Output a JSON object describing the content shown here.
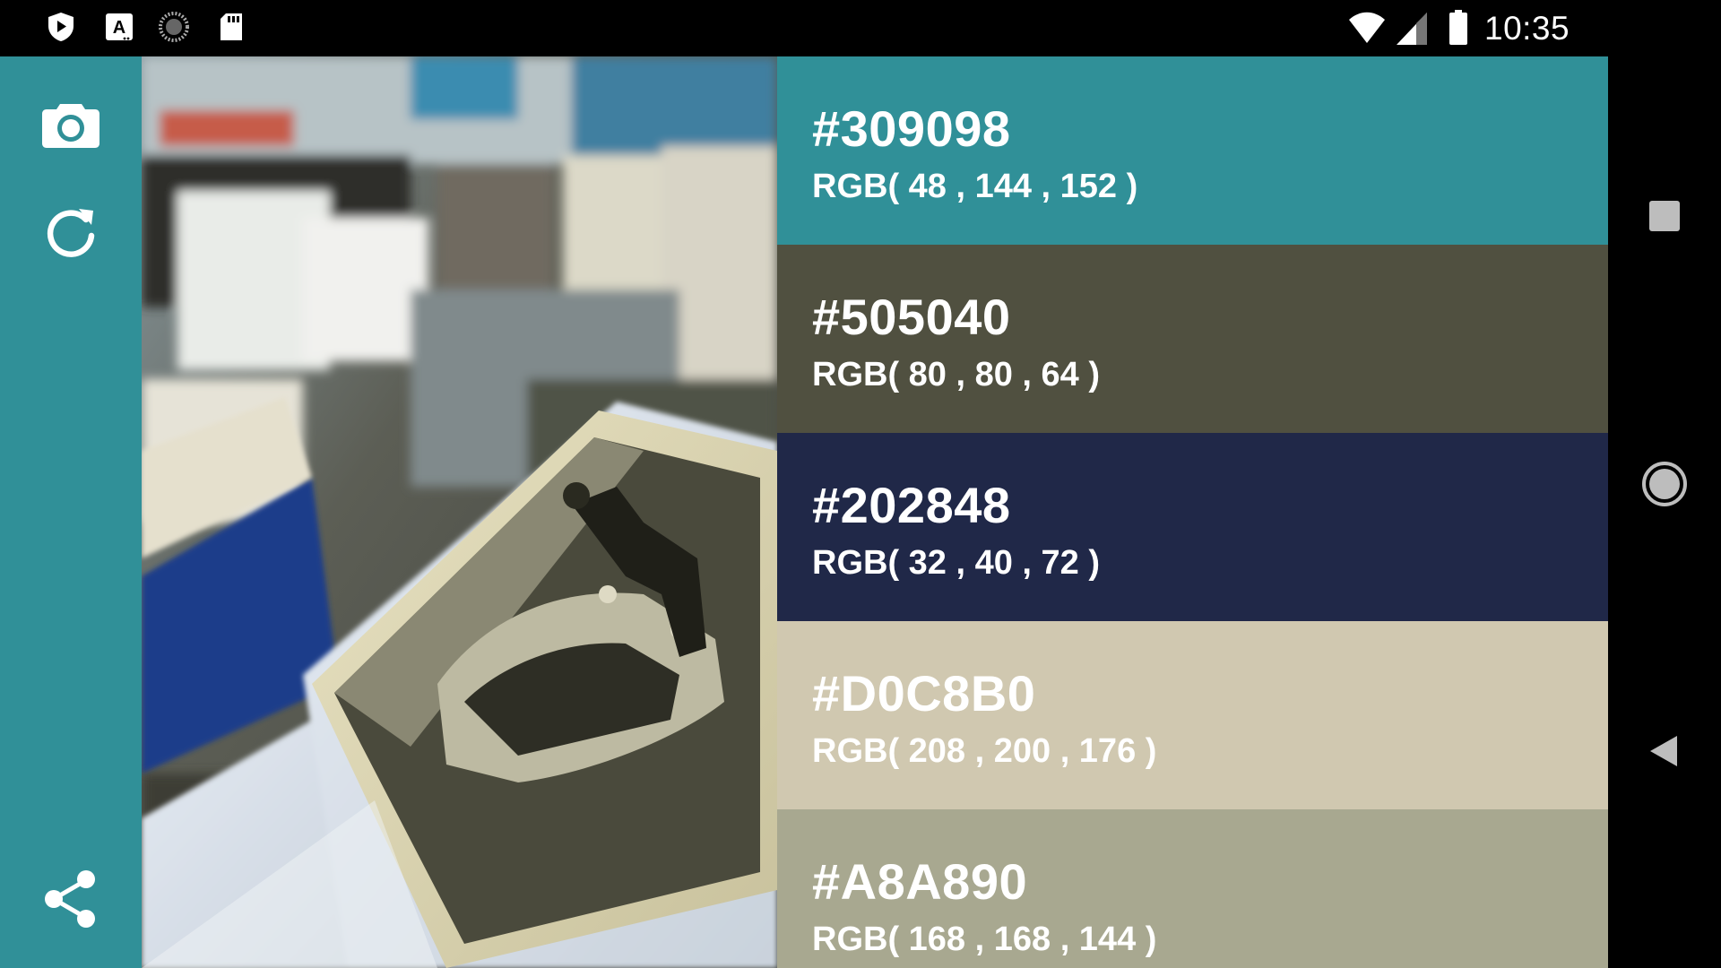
{
  "status_bar": {
    "time": "10:35",
    "icons": [
      "play-protect-icon",
      "font-a-icon",
      "loading-dial-icon",
      "sd-card-icon"
    ],
    "right_icons": [
      "wifi-icon",
      "cell-signal-icon",
      "battery-icon"
    ]
  },
  "rail": {
    "background": "#309098",
    "buttons": [
      "camera-icon",
      "refresh-icon",
      "share-icon"
    ]
  },
  "palette": {
    "swatches": [
      {
        "hex": "#309098",
        "rgb": "RGB( 48 , 144 , 152 )",
        "color": "#309098",
        "text_color": "#FFFFFF"
      },
      {
        "hex": "#505040",
        "rgb": "RGB( 80 , 80 , 64 )",
        "color": "#505040",
        "text_color": "#FFFFFF"
      },
      {
        "hex": "#202848",
        "rgb": "RGB( 32 , 40 , 72 )",
        "color": "#202848",
        "text_color": "#FFFFFF"
      },
      {
        "hex": "#D0C8B0",
        "rgb": "RGB( 208 , 200 , 176 )",
        "color": "#D0C8B0",
        "text_color": "#FFFFFF"
      },
      {
        "hex": "#A8A890",
        "rgb": "RGB( 168 , 168 , 144 )",
        "color": "#A8A890",
        "text_color": "#FFFFFF"
      }
    ]
  },
  "navigation": {
    "buttons": [
      "recents-icon",
      "home-icon",
      "back-icon"
    ]
  }
}
